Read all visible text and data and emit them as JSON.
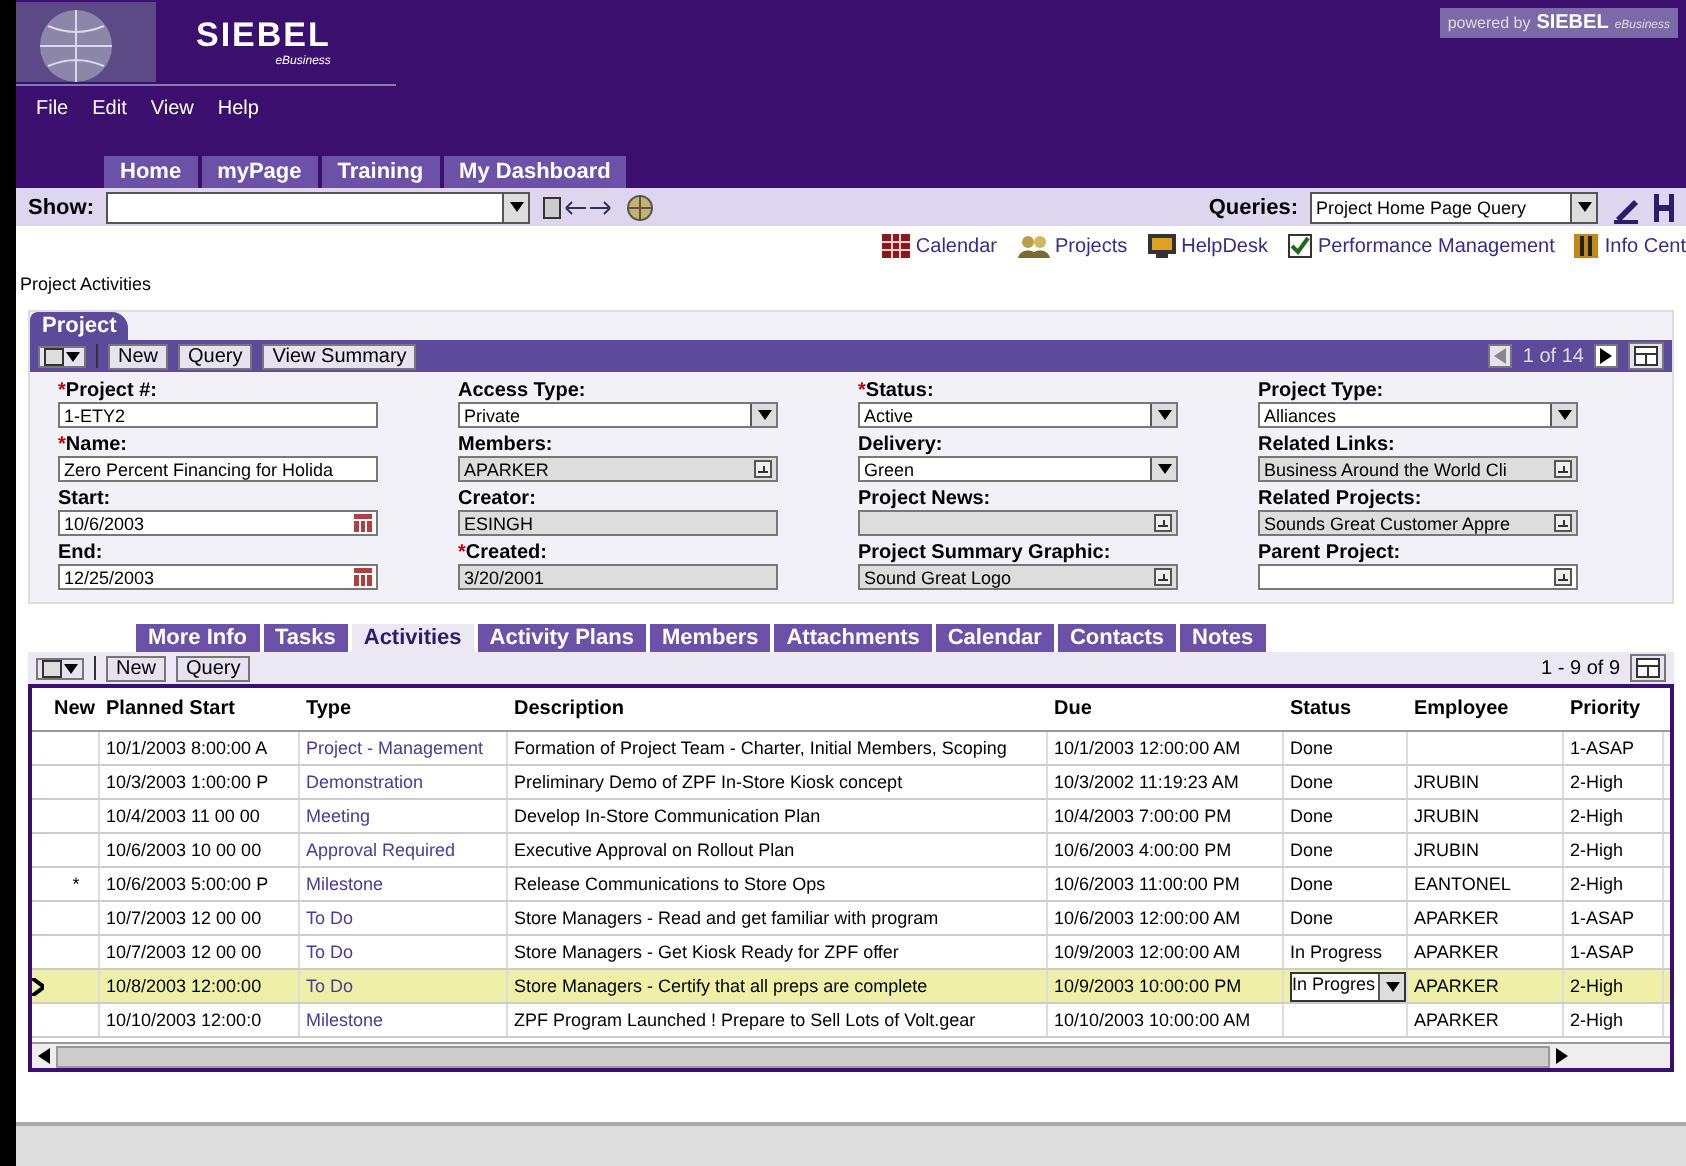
{
  "header": {
    "logo": "SIEBEL",
    "logo_sub": "eBusiness",
    "powered_by": "powered by",
    "powered_brand": "SIEBEL",
    "powered_sub": "eBusiness"
  },
  "menu": [
    "File",
    "Edit",
    "View",
    "Help"
  ],
  "top_tabs": [
    {
      "label": "Home",
      "selected": false
    },
    {
      "label": "myPage",
      "selected": false
    },
    {
      "label": "Training",
      "selected": false
    },
    {
      "label": "My Dashboard",
      "selected": false
    }
  ],
  "toolbar": {
    "show_label": "Show:",
    "queries_label": "Queries:",
    "query_value": "Project Home Page Query"
  },
  "screen_tabs": [
    {
      "label": "Calendar"
    },
    {
      "label": "Projects"
    },
    {
      "label": "HelpDesk"
    },
    {
      "label": "Performance Management"
    },
    {
      "label": "Info Cent"
    }
  ],
  "breadcrumb": "Project Activities",
  "project": {
    "title": "Project",
    "buttons": [
      "New",
      "Query",
      "View Summary"
    ],
    "record_nav": "1 of 14",
    "columns": [
      [
        {
          "label": "Project #:",
          "required": true,
          "kind": "text",
          "value": "1-ETY2",
          "disabled": false
        },
        {
          "label": "Name:",
          "required": true,
          "kind": "text",
          "value": "Zero Percent Financing for Holida",
          "disabled": false
        },
        {
          "label": "Start:",
          "required": false,
          "kind": "date",
          "value": "10/6/2003",
          "disabled": false
        },
        {
          "label": "End:",
          "required": false,
          "kind": "date",
          "value": "12/25/2003",
          "disabled": false
        }
      ],
      [
        {
          "label": "Access Type:",
          "required": false,
          "kind": "select",
          "value": "Private",
          "disabled": false
        },
        {
          "label": "Members:",
          "required": false,
          "kind": "pick",
          "value": "APARKER",
          "disabled": true
        },
        {
          "label": "Creator:",
          "required": false,
          "kind": "text",
          "value": "ESINGH",
          "disabled": true
        },
        {
          "label": "Created:",
          "required": true,
          "kind": "text",
          "value": "3/20/2001",
          "disabled": true
        }
      ],
      [
        {
          "label": "Status:",
          "required": true,
          "kind": "select",
          "value": "Active",
          "disabled": false
        },
        {
          "label": "Delivery:",
          "required": false,
          "kind": "select",
          "value": "Green",
          "disabled": false
        },
        {
          "label": "Project News:",
          "required": false,
          "kind": "pick",
          "disabled": true
        },
        {
          "label": "Project Summary Graphic:",
          "required": false,
          "kind": "pick",
          "value": "Sound Great Logo",
          "disabled": true
        }
      ],
      [
        {
          "label": "Project Type:",
          "required": false,
          "kind": "select",
          "value": "Alliances",
          "disabled": false
        },
        {
          "label": "Related Links:",
          "required": false,
          "kind": "pick",
          "value": "Business Around the World Cli",
          "disabled": true
        },
        {
          "label": "Related Projects:",
          "required": false,
          "kind": "pick",
          "value": "Sounds Great Customer Appre",
          "disabled": true
        },
        {
          "label": "Parent Project:",
          "required": false,
          "kind": "pick",
          "disabled": false
        }
      ]
    ]
  },
  "sub_tabs": [
    {
      "label": "More Info",
      "selected": false
    },
    {
      "label": "Tasks",
      "selected": false
    },
    {
      "label": "Activities",
      "selected": true
    },
    {
      "label": "Activity Plans",
      "selected": false
    },
    {
      "label": "Members",
      "selected": false
    },
    {
      "label": "Attachments",
      "selected": false
    },
    {
      "label": "Calendar",
      "selected": false
    },
    {
      "label": "Contacts",
      "selected": false
    },
    {
      "label": "Notes",
      "selected": false
    }
  ],
  "activities": {
    "buttons": [
      "New",
      "Query"
    ],
    "record_count": "1 - 9 of 9",
    "columns": [
      "New",
      "Planned Start",
      "Type",
      "Description",
      "Due",
      "Status",
      "Employee",
      "Priority"
    ],
    "rows": [
      {
        "selected": false,
        "new": "",
        "planned_start": "10/1/2003 8:00:00 A",
        "type": "Project - Management",
        "description": "Formation of Project Team - Charter, Initial Members, Scoping",
        "due": "10/1/2003 12:00:00 AM",
        "status": "Done",
        "employee": "",
        "priority": "1-ASAP"
      },
      {
        "selected": false,
        "new": "",
        "planned_start": "10/3/2003 1:00:00 P",
        "type": "Demonstration",
        "description": "Preliminary Demo of ZPF In-Store Kiosk concept",
        "due": "10/3/2002 11:19:23 AM",
        "status": "Done",
        "employee": "JRUBIN",
        "priority": "2-High"
      },
      {
        "selected": false,
        "new": "",
        "planned_start": "10/4/2003 11 00 00",
        "type": "Meeting",
        "description": "Develop In-Store Communication Plan",
        "due": "10/4/2003 7:00:00 PM",
        "status": "Done",
        "employee": "JRUBIN",
        "priority": "2-High"
      },
      {
        "selected": false,
        "new": "",
        "planned_start": "10/6/2003 10 00 00",
        "type": "Approval Required",
        "description": "Executive Approval on Rollout Plan",
        "due": "10/6/2003 4:00:00 PM",
        "status": "Done",
        "employee": "JRUBIN",
        "priority": "2-High"
      },
      {
        "selected": false,
        "new": "*",
        "planned_start": "10/6/2003 5:00:00 P",
        "type": "Milestone",
        "description": "Release Communications to Store Ops",
        "due": "10/6/2003 11:00:00 PM",
        "status": "Done",
        "employee": "EANTONEL",
        "priority": "2-High"
      },
      {
        "selected": false,
        "new": "",
        "planned_start": "10/7/2003 12 00 00",
        "type": "To Do",
        "description": "Store Managers - Read and get familiar with program",
        "due": "10/6/2003 12:00:00 AM",
        "status": "Done",
        "employee": "APARKER",
        "priority": "1-ASAP"
      },
      {
        "selected": false,
        "new": "",
        "planned_start": "10/7/2003 12 00 00",
        "type": "To Do",
        "description": "Store Managers - Get Kiosk Ready for ZPF offer",
        "due": "10/9/2003 12:00:00 AM",
        "status": "In Progress",
        "employee": "APARKER",
        "priority": "1-ASAP"
      },
      {
        "selected": true,
        "new": "",
        "planned_start": "10/8/2003 12:00:00",
        "type": "To Do",
        "description": "Store Managers - Certify that all preps are complete",
        "due": "10/9/2003 10:00:00 PM",
        "status": "In Progres",
        "employee": "APARKER",
        "priority": "2-High"
      },
      {
        "selected": false,
        "new": "",
        "planned_start": "10/10/2003 12:00:0",
        "type": "Milestone",
        "description": "ZPF Program Launched ! Prepare to Sell Lots of Volt.gear",
        "due": "10/10/2003 10:00:00 AM",
        "status": "",
        "employee": "APARKER",
        "priority": "2-High"
      }
    ]
  }
}
